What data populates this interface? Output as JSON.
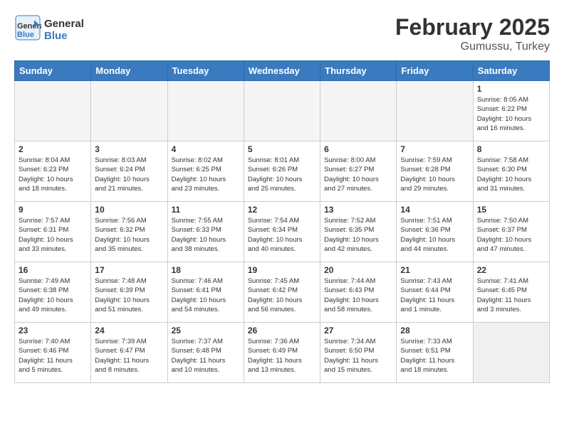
{
  "logo": {
    "line1": "General",
    "line2": "Blue"
  },
  "title": "February 2025",
  "subtitle": "Gumussu, Turkey",
  "weekdays": [
    "Sunday",
    "Monday",
    "Tuesday",
    "Wednesday",
    "Thursday",
    "Friday",
    "Saturday"
  ],
  "weeks": [
    [
      {
        "day": "",
        "info": ""
      },
      {
        "day": "",
        "info": ""
      },
      {
        "day": "",
        "info": ""
      },
      {
        "day": "",
        "info": ""
      },
      {
        "day": "",
        "info": ""
      },
      {
        "day": "",
        "info": ""
      },
      {
        "day": "1",
        "info": "Sunrise: 8:05 AM\nSunset: 6:22 PM\nDaylight: 10 hours\nand 16 minutes."
      }
    ],
    [
      {
        "day": "2",
        "info": "Sunrise: 8:04 AM\nSunset: 6:23 PM\nDaylight: 10 hours\nand 18 minutes."
      },
      {
        "day": "3",
        "info": "Sunrise: 8:03 AM\nSunset: 6:24 PM\nDaylight: 10 hours\nand 21 minutes."
      },
      {
        "day": "4",
        "info": "Sunrise: 8:02 AM\nSunset: 6:25 PM\nDaylight: 10 hours\nand 23 minutes."
      },
      {
        "day": "5",
        "info": "Sunrise: 8:01 AM\nSunset: 6:26 PM\nDaylight: 10 hours\nand 25 minutes."
      },
      {
        "day": "6",
        "info": "Sunrise: 8:00 AM\nSunset: 6:27 PM\nDaylight: 10 hours\nand 27 minutes."
      },
      {
        "day": "7",
        "info": "Sunrise: 7:59 AM\nSunset: 6:28 PM\nDaylight: 10 hours\nand 29 minutes."
      },
      {
        "day": "8",
        "info": "Sunrise: 7:58 AM\nSunset: 6:30 PM\nDaylight: 10 hours\nand 31 minutes."
      }
    ],
    [
      {
        "day": "9",
        "info": "Sunrise: 7:57 AM\nSunset: 6:31 PM\nDaylight: 10 hours\nand 33 minutes."
      },
      {
        "day": "10",
        "info": "Sunrise: 7:56 AM\nSunset: 6:32 PM\nDaylight: 10 hours\nand 35 minutes."
      },
      {
        "day": "11",
        "info": "Sunrise: 7:55 AM\nSunset: 6:33 PM\nDaylight: 10 hours\nand 38 minutes."
      },
      {
        "day": "12",
        "info": "Sunrise: 7:54 AM\nSunset: 6:34 PM\nDaylight: 10 hours\nand 40 minutes."
      },
      {
        "day": "13",
        "info": "Sunrise: 7:52 AM\nSunset: 6:35 PM\nDaylight: 10 hours\nand 42 minutes."
      },
      {
        "day": "14",
        "info": "Sunrise: 7:51 AM\nSunset: 6:36 PM\nDaylight: 10 hours\nand 44 minutes."
      },
      {
        "day": "15",
        "info": "Sunrise: 7:50 AM\nSunset: 6:37 PM\nDaylight: 10 hours\nand 47 minutes."
      }
    ],
    [
      {
        "day": "16",
        "info": "Sunrise: 7:49 AM\nSunset: 6:38 PM\nDaylight: 10 hours\nand 49 minutes."
      },
      {
        "day": "17",
        "info": "Sunrise: 7:48 AM\nSunset: 6:39 PM\nDaylight: 10 hours\nand 51 minutes."
      },
      {
        "day": "18",
        "info": "Sunrise: 7:46 AM\nSunset: 6:41 PM\nDaylight: 10 hours\nand 54 minutes."
      },
      {
        "day": "19",
        "info": "Sunrise: 7:45 AM\nSunset: 6:42 PM\nDaylight: 10 hours\nand 56 minutes."
      },
      {
        "day": "20",
        "info": "Sunrise: 7:44 AM\nSunset: 6:43 PM\nDaylight: 10 hours\nand 58 minutes."
      },
      {
        "day": "21",
        "info": "Sunrise: 7:43 AM\nSunset: 6:44 PM\nDaylight: 11 hours\nand 1 minute."
      },
      {
        "day": "22",
        "info": "Sunrise: 7:41 AM\nSunset: 6:45 PM\nDaylight: 11 hours\nand 3 minutes."
      }
    ],
    [
      {
        "day": "23",
        "info": "Sunrise: 7:40 AM\nSunset: 6:46 PM\nDaylight: 11 hours\nand 5 minutes."
      },
      {
        "day": "24",
        "info": "Sunrise: 7:39 AM\nSunset: 6:47 PM\nDaylight: 11 hours\nand 8 minutes."
      },
      {
        "day": "25",
        "info": "Sunrise: 7:37 AM\nSunset: 6:48 PM\nDaylight: 11 hours\nand 10 minutes."
      },
      {
        "day": "26",
        "info": "Sunrise: 7:36 AM\nSunset: 6:49 PM\nDaylight: 11 hours\nand 13 minutes."
      },
      {
        "day": "27",
        "info": "Sunrise: 7:34 AM\nSunset: 6:50 PM\nDaylight: 11 hours\nand 15 minutes."
      },
      {
        "day": "28",
        "info": "Sunrise: 7:33 AM\nSunset: 6:51 PM\nDaylight: 11 hours\nand 18 minutes."
      },
      {
        "day": "",
        "info": ""
      }
    ]
  ]
}
